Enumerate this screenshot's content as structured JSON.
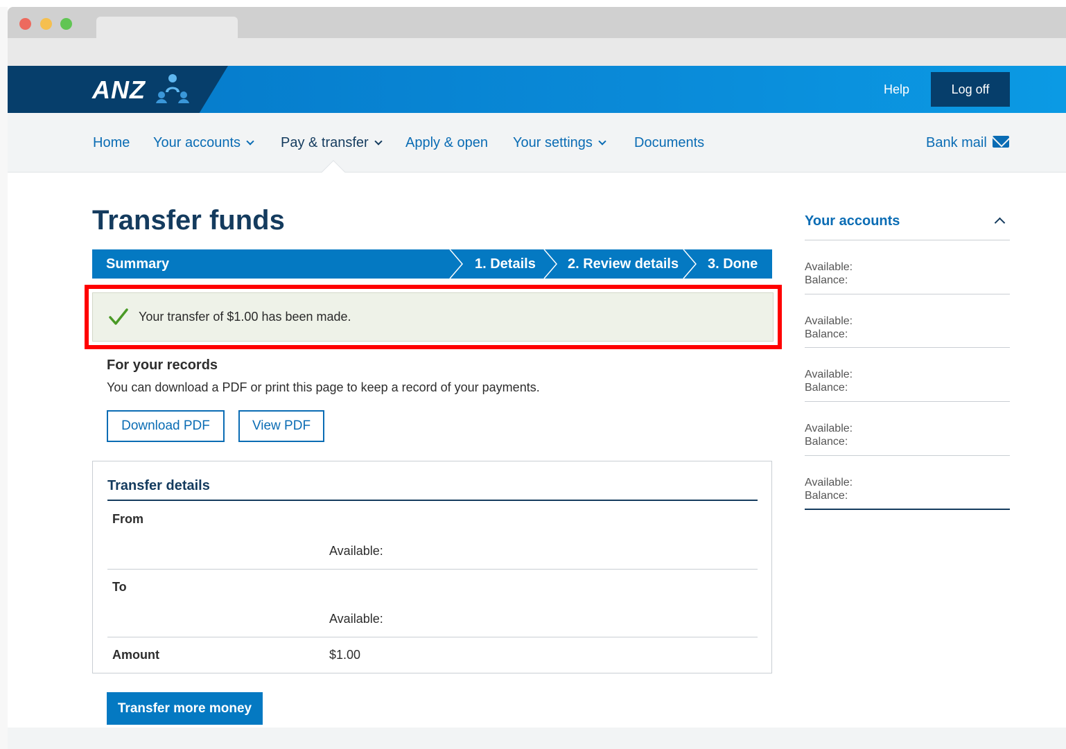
{
  "brand": {
    "logo_text": "ANZ",
    "colors": {
      "primary": "#0479c2",
      "dark": "#063e6b",
      "link": "#0a6cb4",
      "heading": "#143b5e",
      "success": "#4a9a26",
      "highlight": "#ff0000"
    }
  },
  "header": {
    "help_label": "Help",
    "logoff_label": "Log off"
  },
  "nav": {
    "items": [
      {
        "label": "Home",
        "dropdown": false
      },
      {
        "label": "Your accounts",
        "dropdown": true
      },
      {
        "label": "Pay & transfer",
        "dropdown": true,
        "active": true
      },
      {
        "label": "Apply & open",
        "dropdown": false
      },
      {
        "label": "Your settings",
        "dropdown": true
      },
      {
        "label": "Documents",
        "dropdown": false
      }
    ],
    "bank_mail_label": "Bank mail",
    "bank_mail_icon": "envelope-icon"
  },
  "main": {
    "title": "Transfer funds",
    "progress": {
      "summary_label": "Summary",
      "steps": [
        "1. Details",
        "2. Review details",
        "3. Done"
      ]
    },
    "success": {
      "icon": "checkmark-icon",
      "message": "Your transfer of $1.00 has been made."
    },
    "records": {
      "title": "For your records",
      "description": "You can download a PDF or print this page to keep a record of your payments.",
      "download_label": "Download PDF",
      "view_label": "View PDF"
    },
    "transfer_details": {
      "title": "Transfer details",
      "from_label": "From",
      "from_available_label": "Available:",
      "to_label": "To",
      "to_available_label": "Available:",
      "amount_label": "Amount",
      "amount_value": "$1.00"
    },
    "transfer_more_label": "Transfer more money"
  },
  "sidebar": {
    "title": "Your accounts",
    "accounts": [
      {
        "available_label": "Available:",
        "balance_label": "Balance:"
      },
      {
        "available_label": "Available:",
        "balance_label": "Balance:"
      },
      {
        "available_label": "Available:",
        "balance_label": "Balance:"
      },
      {
        "available_label": "Available:",
        "balance_label": "Balance:"
      },
      {
        "available_label": "Available:",
        "balance_label": "Balance:"
      }
    ]
  }
}
